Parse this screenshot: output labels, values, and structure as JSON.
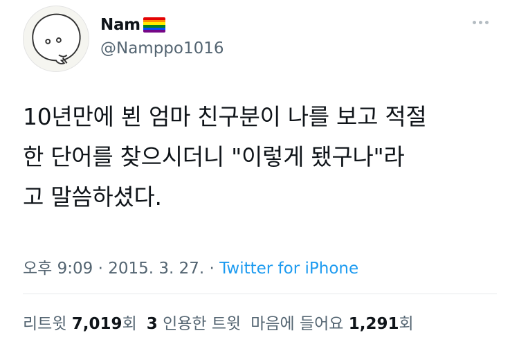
{
  "user": {
    "name": "Nam",
    "handle": "@Namppo1016",
    "flag_colors": [
      "#e40303",
      "#ff8c00",
      "#ffed00",
      "#008026",
      "#004dff",
      "#750787"
    ]
  },
  "more_icon": "more-horizontal-icon",
  "tweet": {
    "lines": [
      "10년만에 뵌 엄마 친구분이 나를 보고 적절",
      "한 단어를 찾으시더니 \"이렇게 됐구나\"라",
      "고 말씀하셨다."
    ]
  },
  "meta": {
    "time": "오후 9:09",
    "sep1": " · ",
    "date": "2015. 3. 27.",
    "sep2": " · ",
    "source": "Twitter for iPhone"
  },
  "stats": {
    "retweets_label": "리트윗",
    "retweets_count": "7,019",
    "retweets_unit": "회",
    "quotes_count": "3",
    "quotes_label": "인용한 트윗",
    "likes_label": "마음에 들어요",
    "likes_count": "1,291",
    "likes_unit": "회"
  },
  "colors": {
    "link": "#1d9bf0",
    "secondary": "#536471",
    "text": "#0f1419"
  }
}
